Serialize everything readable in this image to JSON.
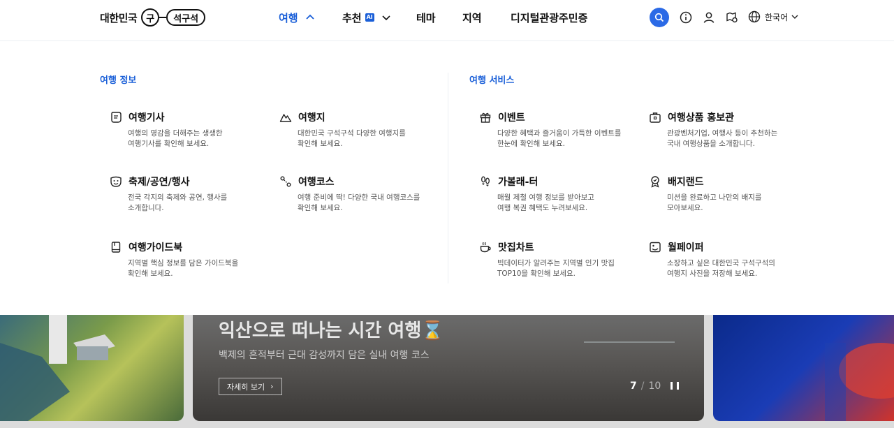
{
  "header": {
    "logo_text": "대한민국",
    "logo_mark_char": "구",
    "logo_mark_pill": "석구석",
    "nav": [
      {
        "label": "여행",
        "active": true,
        "chevron": "chevron-up"
      },
      {
        "label": "추천",
        "badge": "AI",
        "chevron": "chevron-down"
      },
      {
        "label": "테마"
      },
      {
        "label": "지역"
      },
      {
        "label": "디지털관광주민증"
      }
    ],
    "icons": [
      "search-icon",
      "info-icon",
      "user-icon",
      "map-pin-icon",
      "globe-icon"
    ],
    "language": "한국어"
  },
  "mega_menu": {
    "travel_info": {
      "title": "여행 정보",
      "items": [
        {
          "title": "여행기사",
          "desc1": "여행의 영감을 더해주는 생생한",
          "desc2": "여행기사를 확인해 보세요.",
          "icon": "article-icon"
        },
        {
          "title": "여행지",
          "desc1": "대한민국 구석구석 다양한 여행지를",
          "desc2": "확인해 보세요.",
          "icon": "mountain-icon"
        },
        {
          "title": "축제/공연/행사",
          "desc1": "전국 각지의 축제와 공연, 행사를",
          "desc2": "소개합니다.",
          "icon": "mask-icon"
        },
        {
          "title": "여행코스",
          "desc1": "여행 준비에 딱! 다양한 국내 여행코스를",
          "desc2": "확인해 보세요.",
          "icon": "route-icon"
        },
        {
          "title": "여행가이드북",
          "desc1": "지역별 핵심 정보를 담은 가이드북을",
          "desc2": "확인해 보세요.",
          "icon": "guidebook-icon"
        }
      ]
    },
    "travel_service": {
      "title": "여행 서비스",
      "items": [
        {
          "title": "이벤트",
          "desc1": "다양한 혜택과 즐거움이 가득한 이벤트를",
          "desc2": "한눈에 확인해 보세요.",
          "icon": "gift-icon"
        },
        {
          "title": "여행상품 홍보관",
          "desc1": "관광벤처기업, 여행사 등이 추천하는",
          "desc2": "국내 여행상품을 소개합니다.",
          "icon": "briefcase-icon"
        },
        {
          "title": "가볼래-터",
          "desc1": "매월 제철 여행 정보를 받아보고",
          "desc2": "여행 복권 혜택도 누려보세요.",
          "icon": "footprints-icon"
        },
        {
          "title": "배지랜드",
          "desc1": "미션을 완료하고 나만의 배지를",
          "desc2": "모아보세요.",
          "icon": "badge-icon"
        },
        {
          "title": "맛집차트",
          "desc1": "빅데이터가 알려주는 지역별 인기 맛집",
          "desc2": "TOP10을 확인해 보세요.",
          "icon": "cup-icon"
        },
        {
          "title": "월페이퍼",
          "desc1": "소장하고 싶은 대한민국 구석구석의",
          "desc2": "여행지 사진을 저장해 보세요.",
          "icon": "wallpaper-icon"
        }
      ]
    }
  },
  "carousel": {
    "title": "익산으로 떠나는 시간 여행⌛",
    "subtitle": "백제의 흔적부터 근대 감성까지 담은 실내 여행 코스",
    "button_label": "자세히 보기",
    "button_chevron": "›",
    "current": "7",
    "separator": "/",
    "total": "10"
  }
}
